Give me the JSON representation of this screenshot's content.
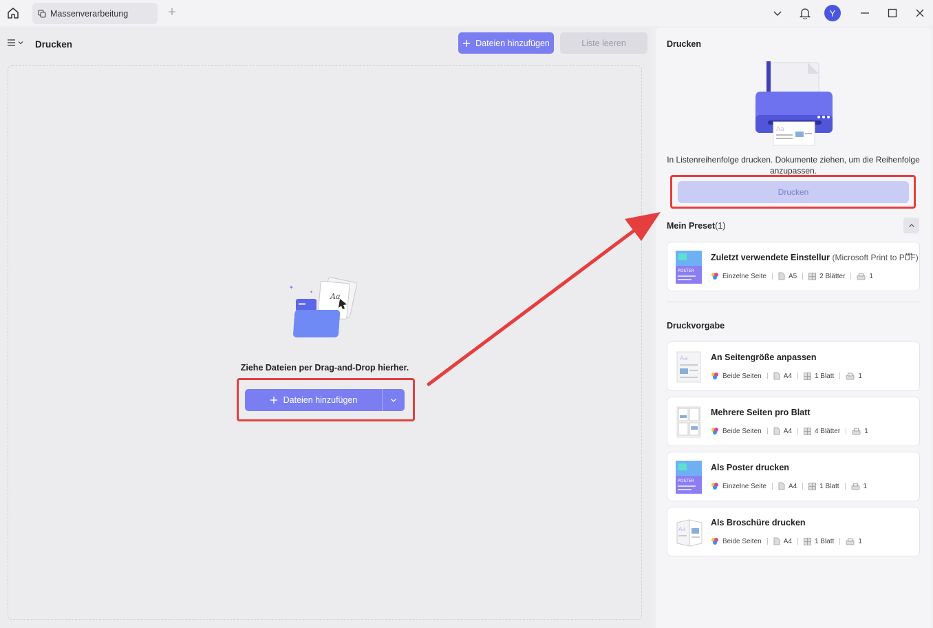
{
  "titlebar": {
    "tab_label": "Massenverarbeitung",
    "avatar_letter": "Y"
  },
  "left": {
    "page_title": "Drucken",
    "add_files_label": "Dateien hinzufügen",
    "clear_list_label": "Liste leeren",
    "drop_text": "Ziehe Dateien per Drag-and-Drop hierher.",
    "add_files_main_label": "Dateien hinzufügen"
  },
  "right": {
    "title": "Drucken",
    "description": "In Listenreihenfolge drucken. Dokumente ziehen, um die Reihenfolge anzupassen.",
    "print_button": "Drucken",
    "preset_section": "Mein Preset",
    "preset_count": "(1)",
    "presets": [
      {
        "title": "Zuletzt verwendete Einstellur",
        "subtitle": "(Microsoft Print to PDF)",
        "sides": "Einzelne Seite",
        "size": "A5",
        "sheets": "2 Blätter",
        "copies": "1"
      }
    ],
    "template_section": "Druckvorgabe",
    "templates": [
      {
        "title": "An Seitengröße anpassen",
        "sides": "Beide Seiten",
        "size": "A4",
        "sheets": "1 Blatt",
        "copies": "1"
      },
      {
        "title": "Mehrere Seiten pro Blatt",
        "sides": "Beide Seiten",
        "size": "A4",
        "sheets": "4 Blätter",
        "copies": "1"
      },
      {
        "title": "Als Poster drucken",
        "sides": "Einzelne Seite",
        "size": "A4",
        "sheets": "1 Blatt",
        "copies": "1"
      },
      {
        "title": "Als Broschüre drucken",
        "sides": "Beide Seiten",
        "size": "A4",
        "sheets": "1 Blatt",
        "copies": "1"
      }
    ]
  },
  "colors": {
    "accent": "#7b7ef0",
    "highlight": "#e53e3e",
    "print_disabled": "#c9ccf5"
  }
}
